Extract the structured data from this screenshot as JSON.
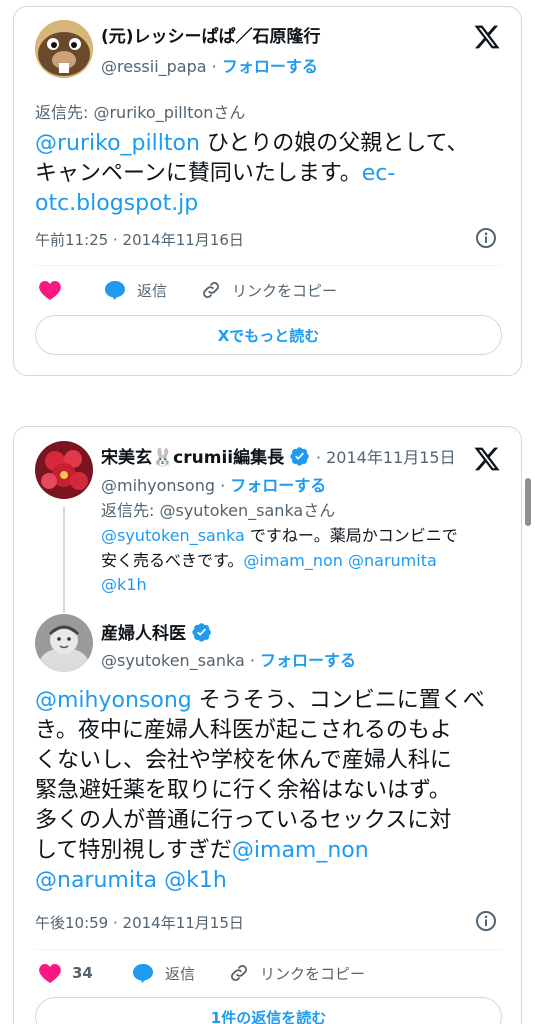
{
  "tweet1": {
    "author_name": "(元)レッシーぱぱ／石原隆行",
    "handle": "@ressii_papa",
    "separator": " · ",
    "follow_label": "フォローする",
    "reply_to": "返信先: @ruriko_pilltonさん",
    "mention": "@ruriko_pillton",
    "text_line1_rest": " ひとりの娘の父親として、",
    "text_line2": "キャンペーンに賛同いたします。",
    "link_part1": "ec-",
    "link_part2": "otc.blogspot.jp",
    "timestamp": "午前11:25 · 2014年11月16日",
    "reply_label": "返信",
    "copy_link_label": "リンクをコピー",
    "read_more_label": "Xでもっと読む"
  },
  "tweet2": {
    "quoted": {
      "author_name": "宋美玄🐰crumii編集長",
      "date": "2014年11月15日",
      "handle": "@mihyonsong",
      "separator": " · ",
      "follow_label": "フォローする",
      "reply_to": "返信先: @syutoken_sankaさん",
      "mention": "@syutoken_sanka",
      "text_part1": " ですねー。薬局かコンビニで",
      "text_line2": "安く売るべきです。",
      "mention2": "@imam_non",
      "mention3": "@narumita",
      "mention4": "@k1h"
    },
    "author_name": "産婦人科医",
    "handle": "@syutoken_sanka",
    "separator": " · ",
    "follow_label": "フォローする",
    "mention": "@mihyonsong",
    "text_line1_rest": " そうそう、コンビニに置くべ",
    "text_line2": "き。夜中に産婦人科医が起こされるのもよ",
    "text_line3": "くないし、会社や学校を休んで産婦人科に",
    "text_line4": "緊急避妊薬を取りに行く余裕はないはず。",
    "text_line5": "多くの人が普通に行っているセックスに対",
    "text_line6_plain": "して特別視しすぎだ",
    "mention_imam": "@imam_non",
    "mention_narumita": "@narumita",
    "mention_k1h": "@k1h",
    "timestamp": "午後10:59 · 2014年11月15日",
    "like_count": "34",
    "reply_label": "返信",
    "copy_link_label": "リンクをコピー",
    "read_replies_label": "1件の返信を読む"
  },
  "colors": {
    "link": "#1d9bf0",
    "heart": "#f91880",
    "text": "#0f1419",
    "secondary": "#536471"
  }
}
